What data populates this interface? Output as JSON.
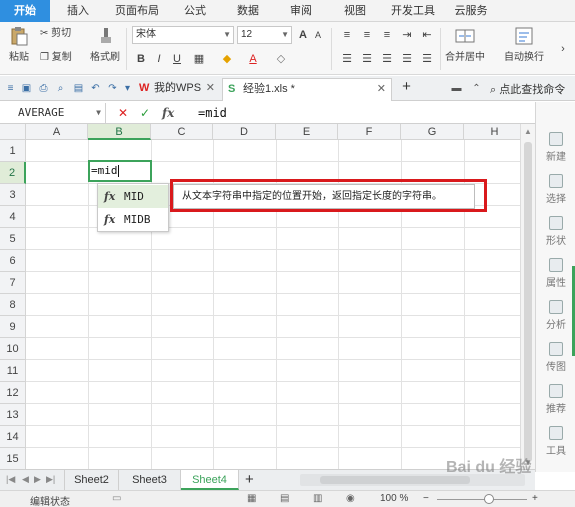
{
  "menu": [
    "开始",
    "插入",
    "页面布局",
    "公式",
    "数据",
    "审阅",
    "视图",
    "开发工具",
    "云服务"
  ],
  "ribbon": {
    "paste": "粘贴",
    "cut": "剪切",
    "copy": "复制",
    "format_painter": "格式刷",
    "font": "宋体",
    "size": "12",
    "merge": "合并居中",
    "wrap": "自动换行",
    "bold": "B",
    "italic": "I",
    "underline": "U",
    "font_color": "A"
  },
  "tabs": {
    "wps": "我的WPS",
    "file": "经验1.xls *",
    "add": "+",
    "find": "点此查找命令"
  },
  "formula_bar": {
    "name_box": "AVERAGE",
    "cancel": "✕",
    "confirm": "✓",
    "fx": "fx",
    "content": "=mid"
  },
  "grid": {
    "columns": [
      "A",
      "B",
      "C",
      "D",
      "E",
      "F",
      "G",
      "H"
    ],
    "rows": [
      "1",
      "2",
      "3",
      "4",
      "5",
      "6",
      "7",
      "8",
      "9",
      "10",
      "11",
      "12",
      "13",
      "14",
      "15"
    ],
    "active_cell_text": "=mid"
  },
  "autocomplete": {
    "fx": "fx",
    "items": [
      "MID",
      "MIDB"
    ],
    "tooltip": "从文本字符串中指定的位置开始，返回指定长度的字符串。"
  },
  "side_panel": [
    "新建",
    "选择",
    "形状",
    "属性",
    "分析",
    "传图",
    "推荐",
    "工具"
  ],
  "sheets": [
    "Sheet2",
    "Sheet3",
    "Sheet4"
  ],
  "status": {
    "mode": "编辑状态",
    "zoom": "100 %",
    "minus": "−",
    "plus": "+"
  },
  "watermark": "Bai du 经验",
  "colors": {
    "accent": "#3ca35b",
    "menu_active": "#2f8fe0",
    "highlight": "#d9191c"
  }
}
